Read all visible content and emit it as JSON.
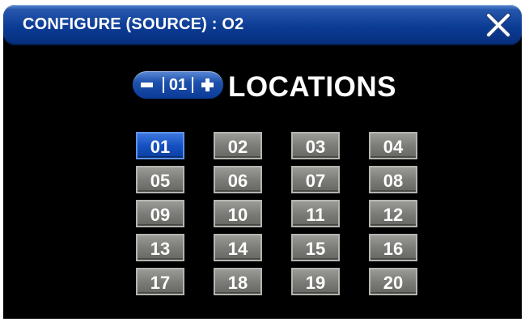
{
  "window": {
    "title": "CONFIGURE (SOURCE) : O2",
    "close_icon": "close-icon"
  },
  "counter": {
    "value": "01",
    "decrement_icon": "minus-icon",
    "increment_icon": "plus-icon",
    "label": "LOCATIONS"
  },
  "locations": {
    "selected": "01",
    "items": [
      "01",
      "02",
      "03",
      "04",
      "05",
      "06",
      "07",
      "08",
      "09",
      "10",
      "11",
      "12",
      "13",
      "14",
      "15",
      "16",
      "17",
      "18",
      "19",
      "20"
    ]
  },
  "colors": {
    "accent": "#0b3b93",
    "selected": "#1551c2",
    "button": "#7c7c78",
    "background": "#000000",
    "text": "#ffffff"
  }
}
